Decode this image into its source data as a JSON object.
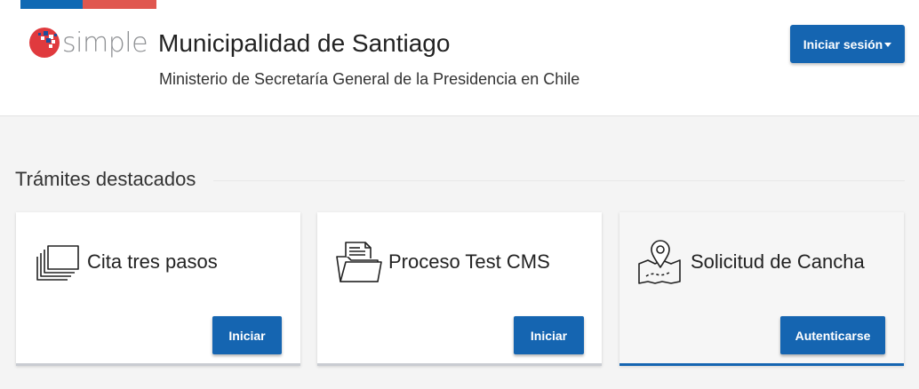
{
  "header": {
    "logo_text": "simple",
    "title": "Municipalidad de Santiago",
    "subtitle": "Ministerio de Secretaría General de la Presidencia en Chile",
    "login_label": "Iniciar sesión"
  },
  "section": {
    "title": "Trámites destacados"
  },
  "cards": [
    {
      "title": "Cita tres pasos",
      "button": "Iniciar",
      "icon": "stacked-windows-icon"
    },
    {
      "title": "Proceso Test CMS",
      "button": "Iniciar",
      "icon": "folder-documents-icon"
    },
    {
      "title": "Solicitud de Cancha",
      "button": "Autenticarse",
      "icon": "map-pin-icon"
    }
  ],
  "colors": {
    "primary": "#1565b1",
    "flag_blue": "#0f69b4",
    "flag_red": "#e0574f",
    "background": "#f4f4f4"
  }
}
